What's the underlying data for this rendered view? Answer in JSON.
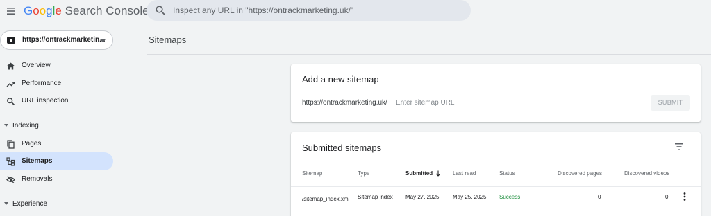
{
  "header": {
    "logo_google": "Google",
    "logo_product": "Search Console",
    "search_placeholder": "Inspect any URL in \"https://ontrackmarketing.uk/\""
  },
  "property": {
    "label": "https://ontrackmarketin..."
  },
  "sidebar": {
    "items": [
      {
        "label": "Overview",
        "icon": "home-icon"
      },
      {
        "label": "Performance",
        "icon": "trending-up-icon"
      },
      {
        "label": "URL inspection",
        "icon": "search-icon"
      }
    ],
    "sections": [
      {
        "label": "Indexing",
        "items": [
          {
            "label": "Pages",
            "icon": "pages-icon"
          },
          {
            "label": "Sitemaps",
            "icon": "sitemap-icon",
            "active": true
          },
          {
            "label": "Removals",
            "icon": "removals-icon"
          }
        ]
      },
      {
        "label": "Experience",
        "items": []
      }
    ]
  },
  "main": {
    "title": "Sitemaps",
    "add_card": {
      "title": "Add a new sitemap",
      "prefix": "https://ontrackmarketing.uk/",
      "input_placeholder": "Enter sitemap URL",
      "submit_label": "SUBMIT"
    },
    "submitted": {
      "title": "Submitted sitemaps",
      "columns": [
        "Sitemap",
        "Type",
        "Submitted",
        "Last read",
        "Status",
        "Discovered pages",
        "Discovered videos"
      ],
      "sorted_column": "Submitted",
      "rows": [
        {
          "sitemap": "/sitemap_index.xml",
          "type": "Sitemap index",
          "submitted": "May 27, 2025",
          "last_read": "May 25, 2025",
          "status": "Success",
          "discovered_pages": "0",
          "discovered_videos": "0"
        }
      ]
    }
  },
  "colors": {
    "accent_active": "#d3e3fd",
    "success": "#1e8e3e",
    "background": "#f1f3f4"
  }
}
